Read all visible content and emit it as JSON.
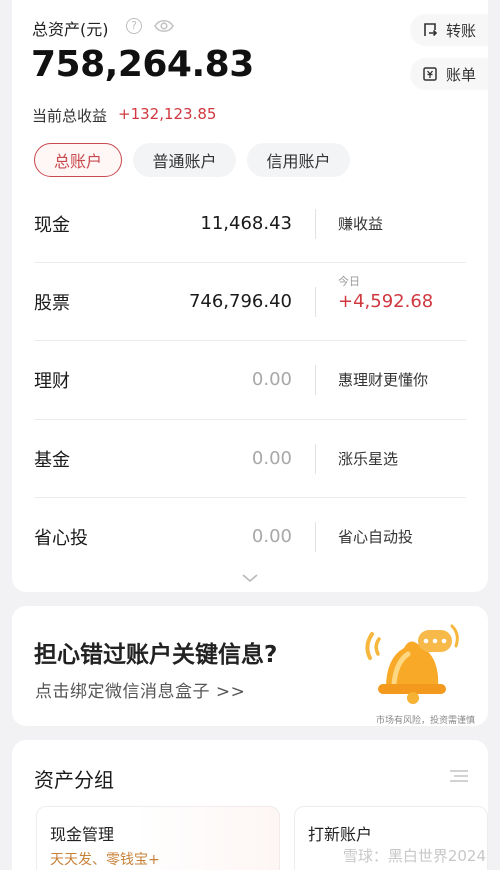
{
  "header": {
    "assets_label": "总资产(元)",
    "total_value": "758,264.83",
    "income_label": "当前总收益",
    "income_value": "+132,123.85"
  },
  "actions": {
    "transfer_label": "转账",
    "bill_label": "账单"
  },
  "tabs": [
    {
      "label": "总账户",
      "active": true
    },
    {
      "label": "普通账户",
      "active": false
    },
    {
      "label": "信用账户",
      "active": false
    }
  ],
  "accounts": [
    {
      "name": "现金",
      "value": "11,468.43",
      "aux": "赚收益"
    },
    {
      "name": "股票",
      "value": "746,796.40",
      "aux_small": "今日",
      "aux": "+4,592.68"
    },
    {
      "name": "理财",
      "value": "0.00",
      "aux": "惠理财更懂你"
    },
    {
      "name": "基金",
      "value": "0.00",
      "aux": "涨乐星选"
    },
    {
      "name": "省心投",
      "value": "0.00",
      "aux": "省心自动投"
    }
  ],
  "promo": {
    "title": "担心错过账户关键信息?",
    "subtitle": "点击绑定微信消息盒子 >>",
    "risk_note": "市场有风险，投资需谨慎"
  },
  "group": {
    "title": "资产分组",
    "cards": [
      {
        "title": "现金管理",
        "subtitle": "天天发、零钱宝+"
      },
      {
        "title": "打新账户",
        "subtitle": ""
      }
    ]
  },
  "watermark": "雪球：黑白世界2024",
  "colors": {
    "accent_red": "#d0383f",
    "tab_border": "#c8494e",
    "bell_orange": "#f6a623",
    "subtitle_gold": "#c7823a"
  }
}
